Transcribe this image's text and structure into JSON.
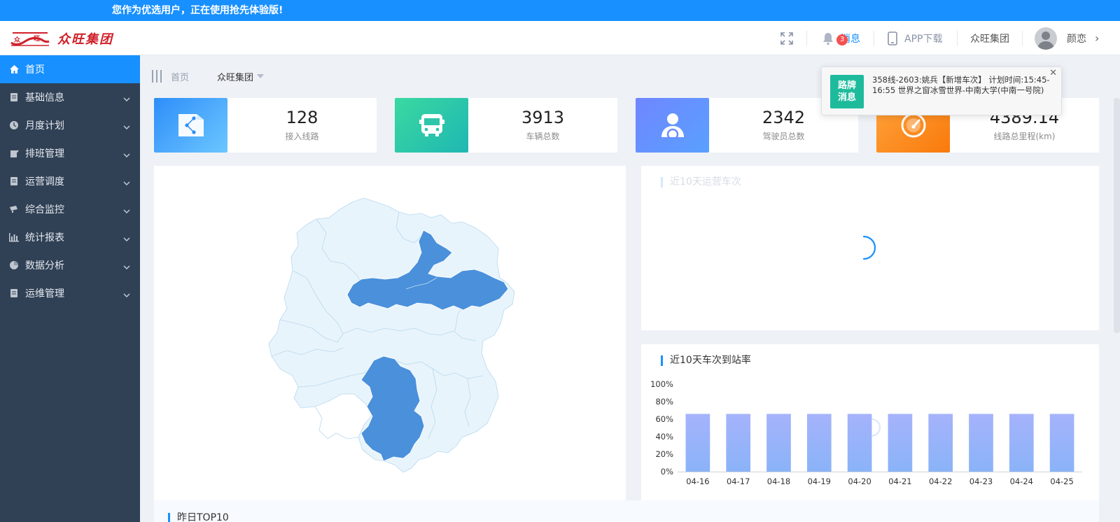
{
  "banner": {
    "text": "您作为优选用户，正在使用抢先体验版!"
  },
  "header": {
    "logo_text": "众旺集团",
    "logo_mark_text": "众旺",
    "messages_label": "消息",
    "messages_badge": "3",
    "app_download_label": "APP下载",
    "org_label": "众旺集团",
    "user_name": "颜恋"
  },
  "sidebar": {
    "items": [
      {
        "label": "首页",
        "icon": "home-icon",
        "active": true
      },
      {
        "label": "基础信息",
        "icon": "document-icon"
      },
      {
        "label": "月度计划",
        "icon": "clock-icon"
      },
      {
        "label": "排班管理",
        "icon": "edit-icon"
      },
      {
        "label": "运营调度",
        "icon": "document-icon"
      },
      {
        "label": "综合监控",
        "icon": "camera-icon"
      },
      {
        "label": "统计报表",
        "icon": "bar-chart-icon"
      },
      {
        "label": "数据分析",
        "icon": "pie-chart-icon"
      },
      {
        "label": "运维管理",
        "icon": "document-icon"
      }
    ]
  },
  "breadcrumb": {
    "home": "首页",
    "org_select": "众旺集团"
  },
  "stats": [
    {
      "value": "128",
      "label": "接入线路",
      "icon": "share-icon",
      "color_from": "#3aa0ff",
      "color_to": "#66c1ff"
    },
    {
      "value": "3913",
      "label": "车辆总数",
      "icon": "bus-icon",
      "color_from": "#36d6a3",
      "color_to": "#20b9b0"
    },
    {
      "value": "2342",
      "label": "驾驶员总数",
      "icon": "driver-icon",
      "color_from": "#6f8bff",
      "color_to": "#5d9bff"
    },
    {
      "value": "4389.14",
      "label": "线路总里程(km)",
      "icon": "speedometer-icon",
      "color_from": "#ff9a2e",
      "color_to": "#fb7d12"
    }
  ],
  "notification": {
    "tag_line1": "路牌",
    "tag_line2": "消息",
    "text": "358线-2603:姚兵【新增车次】 计划时间:15:45-16:55 世界之窗冰雪世界-中南大学(中南一号院)"
  },
  "panels": {
    "trips_title": "近10天运营车次",
    "arrival_title": "近10天车次到站率",
    "top10_title": "昨日TOP10"
  },
  "chart_data": {
    "type": "bar",
    "title": "近10天车次到站率",
    "categories": [
      "04-16",
      "04-17",
      "04-18",
      "04-19",
      "04-20",
      "04-21",
      "04-22",
      "04-23",
      "04-24",
      "04-25"
    ],
    "values": [
      66,
      66,
      66,
      66,
      66,
      66,
      66,
      66,
      66,
      66
    ],
    "yticks": [
      "0%",
      "20%",
      "40%",
      "60%",
      "80%",
      "100%"
    ],
    "ylim": [
      0,
      100
    ],
    "bar_color_top": "#a5b3fb",
    "bar_color_bottom": "#8ab3f8",
    "grid": false
  },
  "colors": {
    "accent": "#1890ff",
    "sidebar_bg": "#304156",
    "map_fill": "#e8f4fb",
    "map_highlight": "#4a90db"
  }
}
